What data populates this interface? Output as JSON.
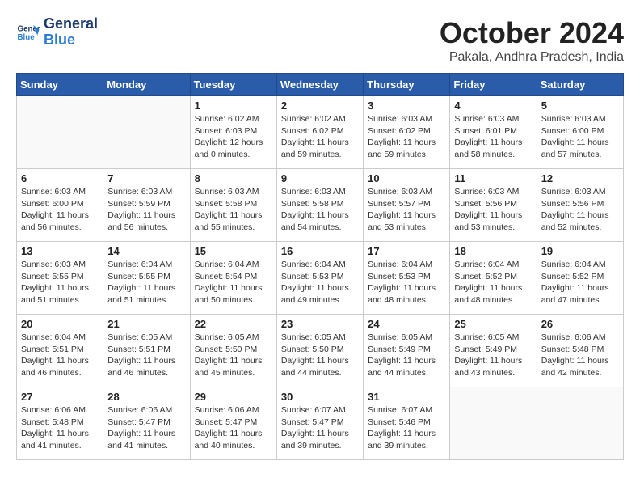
{
  "header": {
    "logo": {
      "line1": "General",
      "line2": "Blue"
    },
    "title": "October 2024",
    "location": "Pakala, Andhra Pradesh, India"
  },
  "weekdays": [
    "Sunday",
    "Monday",
    "Tuesday",
    "Wednesday",
    "Thursday",
    "Friday",
    "Saturday"
  ],
  "weeks": [
    [
      {
        "day": "",
        "info": ""
      },
      {
        "day": "",
        "info": ""
      },
      {
        "day": "1",
        "info": "Sunrise: 6:02 AM\nSunset: 6:03 PM\nDaylight: 12 hours\nand 0 minutes."
      },
      {
        "day": "2",
        "info": "Sunrise: 6:02 AM\nSunset: 6:02 PM\nDaylight: 11 hours\nand 59 minutes."
      },
      {
        "day": "3",
        "info": "Sunrise: 6:03 AM\nSunset: 6:02 PM\nDaylight: 11 hours\nand 59 minutes."
      },
      {
        "day": "4",
        "info": "Sunrise: 6:03 AM\nSunset: 6:01 PM\nDaylight: 11 hours\nand 58 minutes."
      },
      {
        "day": "5",
        "info": "Sunrise: 6:03 AM\nSunset: 6:00 PM\nDaylight: 11 hours\nand 57 minutes."
      }
    ],
    [
      {
        "day": "6",
        "info": "Sunrise: 6:03 AM\nSunset: 6:00 PM\nDaylight: 11 hours\nand 56 minutes."
      },
      {
        "day": "7",
        "info": "Sunrise: 6:03 AM\nSunset: 5:59 PM\nDaylight: 11 hours\nand 56 minutes."
      },
      {
        "day": "8",
        "info": "Sunrise: 6:03 AM\nSunset: 5:58 PM\nDaylight: 11 hours\nand 55 minutes."
      },
      {
        "day": "9",
        "info": "Sunrise: 6:03 AM\nSunset: 5:58 PM\nDaylight: 11 hours\nand 54 minutes."
      },
      {
        "day": "10",
        "info": "Sunrise: 6:03 AM\nSunset: 5:57 PM\nDaylight: 11 hours\nand 53 minutes."
      },
      {
        "day": "11",
        "info": "Sunrise: 6:03 AM\nSunset: 5:56 PM\nDaylight: 11 hours\nand 53 minutes."
      },
      {
        "day": "12",
        "info": "Sunrise: 6:03 AM\nSunset: 5:56 PM\nDaylight: 11 hours\nand 52 minutes."
      }
    ],
    [
      {
        "day": "13",
        "info": "Sunrise: 6:03 AM\nSunset: 5:55 PM\nDaylight: 11 hours\nand 51 minutes."
      },
      {
        "day": "14",
        "info": "Sunrise: 6:04 AM\nSunset: 5:55 PM\nDaylight: 11 hours\nand 51 minutes."
      },
      {
        "day": "15",
        "info": "Sunrise: 6:04 AM\nSunset: 5:54 PM\nDaylight: 11 hours\nand 50 minutes."
      },
      {
        "day": "16",
        "info": "Sunrise: 6:04 AM\nSunset: 5:53 PM\nDaylight: 11 hours\nand 49 minutes."
      },
      {
        "day": "17",
        "info": "Sunrise: 6:04 AM\nSunset: 5:53 PM\nDaylight: 11 hours\nand 48 minutes."
      },
      {
        "day": "18",
        "info": "Sunrise: 6:04 AM\nSunset: 5:52 PM\nDaylight: 11 hours\nand 48 minutes."
      },
      {
        "day": "19",
        "info": "Sunrise: 6:04 AM\nSunset: 5:52 PM\nDaylight: 11 hours\nand 47 minutes."
      }
    ],
    [
      {
        "day": "20",
        "info": "Sunrise: 6:04 AM\nSunset: 5:51 PM\nDaylight: 11 hours\nand 46 minutes."
      },
      {
        "day": "21",
        "info": "Sunrise: 6:05 AM\nSunset: 5:51 PM\nDaylight: 11 hours\nand 46 minutes."
      },
      {
        "day": "22",
        "info": "Sunrise: 6:05 AM\nSunset: 5:50 PM\nDaylight: 11 hours\nand 45 minutes."
      },
      {
        "day": "23",
        "info": "Sunrise: 6:05 AM\nSunset: 5:50 PM\nDaylight: 11 hours\nand 44 minutes."
      },
      {
        "day": "24",
        "info": "Sunrise: 6:05 AM\nSunset: 5:49 PM\nDaylight: 11 hours\nand 44 minutes."
      },
      {
        "day": "25",
        "info": "Sunrise: 6:05 AM\nSunset: 5:49 PM\nDaylight: 11 hours\nand 43 minutes."
      },
      {
        "day": "26",
        "info": "Sunrise: 6:06 AM\nSunset: 5:48 PM\nDaylight: 11 hours\nand 42 minutes."
      }
    ],
    [
      {
        "day": "27",
        "info": "Sunrise: 6:06 AM\nSunset: 5:48 PM\nDaylight: 11 hours\nand 41 minutes."
      },
      {
        "day": "28",
        "info": "Sunrise: 6:06 AM\nSunset: 5:47 PM\nDaylight: 11 hours\nand 41 minutes."
      },
      {
        "day": "29",
        "info": "Sunrise: 6:06 AM\nSunset: 5:47 PM\nDaylight: 11 hours\nand 40 minutes."
      },
      {
        "day": "30",
        "info": "Sunrise: 6:07 AM\nSunset: 5:47 PM\nDaylight: 11 hours\nand 39 minutes."
      },
      {
        "day": "31",
        "info": "Sunrise: 6:07 AM\nSunset: 5:46 PM\nDaylight: 11 hours\nand 39 minutes."
      },
      {
        "day": "",
        "info": ""
      },
      {
        "day": "",
        "info": ""
      }
    ]
  ]
}
